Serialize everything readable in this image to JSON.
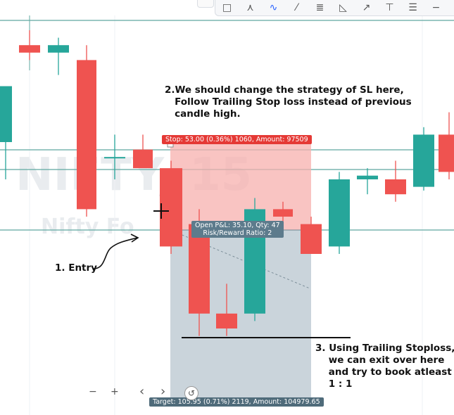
{
  "watermark": {
    "symbol": "NIFTY, 15",
    "name": "Nifty Fo"
  },
  "toolbar": {
    "tools": [
      {
        "icon": "rectangle-icon",
        "glyph": "□"
      },
      {
        "icon": "path-icon",
        "glyph": "⋏"
      },
      {
        "icon": "brush-icon",
        "glyph": "∿",
        "active": true
      },
      {
        "icon": "line-icon",
        "glyph": "⁄"
      },
      {
        "icon": "parallel-lines-icon",
        "glyph": "≣"
      },
      {
        "icon": "triangle-icon",
        "glyph": "◺"
      },
      {
        "icon": "arrow-line-icon",
        "glyph": "↗"
      },
      {
        "icon": "anchor-icon",
        "glyph": "⊤"
      },
      {
        "icon": "fib-icon",
        "glyph": "☰"
      },
      {
        "icon": "minus-icon",
        "glyph": "−"
      }
    ]
  },
  "annotations": {
    "note1": "1. Entry",
    "note2": "2.We should change the strategy of SL here,\n   Follow Trailing Stop loss instead of previous\n   candle high.",
    "note3": "3. Using Trailing Stoploss,\n    we can exit over here\n    and try to book atleast\n    1 : 1"
  },
  "position": {
    "stop_label": "Stop: 53.00 (0.36%) 1060, Amount: 97509",
    "open_pl_label": "Open P&L: 35.10, Qty: 47",
    "risk_reward_label": "Risk/Reward Ratio: 2",
    "target_label": "Target: 105.95 (0.71%) 2119, Amount: 104979.65"
  },
  "nav": {
    "zoom_out": "−",
    "zoom_in": "+",
    "prev": "‹",
    "next": "›",
    "reset": "↺"
  },
  "colors": {
    "bull": "#26a69a",
    "bear": "#ef5350",
    "stop_zone": "#f7b0ad",
    "target_zone": "#9fb0bd",
    "stop_label_bg": "#e53935",
    "pl_label_bg": "#5d7b8c",
    "target_label_bg": "#4f6b7a",
    "level_line": "#5fa8a0"
  },
  "chart_data": {
    "type": "candlestick",
    "note": "Price axis not visible; values are relative chart units (higher = higher price).",
    "candles": [
      {
        "o": 60,
        "h": 75,
        "l": 50,
        "c": 75
      },
      {
        "o": 86,
        "h": 90,
        "l": 82,
        "c": 84
      },
      {
        "o": 84,
        "h": 88,
        "l": 78,
        "c": 86
      },
      {
        "o": 82,
        "h": 86,
        "l": 40,
        "c": 42
      },
      {
        "o": 56,
        "h": 62,
        "l": 50,
        "c": 56
      },
      {
        "o": 58,
        "h": 62,
        "l": 55,
        "c": 53
      },
      {
        "o": 53,
        "h": 55,
        "l": 30,
        "c": 32
      },
      {
        "o": 38,
        "h": 42,
        "l": 8,
        "c": 14
      },
      {
        "o": 14,
        "h": 22,
        "l": 8,
        "c": 10
      },
      {
        "o": 14,
        "h": 45,
        "l": 12,
        "c": 42
      },
      {
        "o": 42,
        "h": 44,
        "l": 36,
        "c": 40
      },
      {
        "o": 38,
        "h": 40,
        "l": 31,
        "c": 30
      },
      {
        "o": 32,
        "h": 52,
        "l": 30,
        "c": 50
      },
      {
        "o": 50,
        "h": 53,
        "l": 46,
        "c": 51
      },
      {
        "o": 50,
        "h": 55,
        "l": 44,
        "c": 46
      },
      {
        "o": 48,
        "h": 64,
        "l": 47,
        "c": 62
      },
      {
        "o": 62,
        "h": 68,
        "l": 50,
        "c": 52
      }
    ]
  }
}
